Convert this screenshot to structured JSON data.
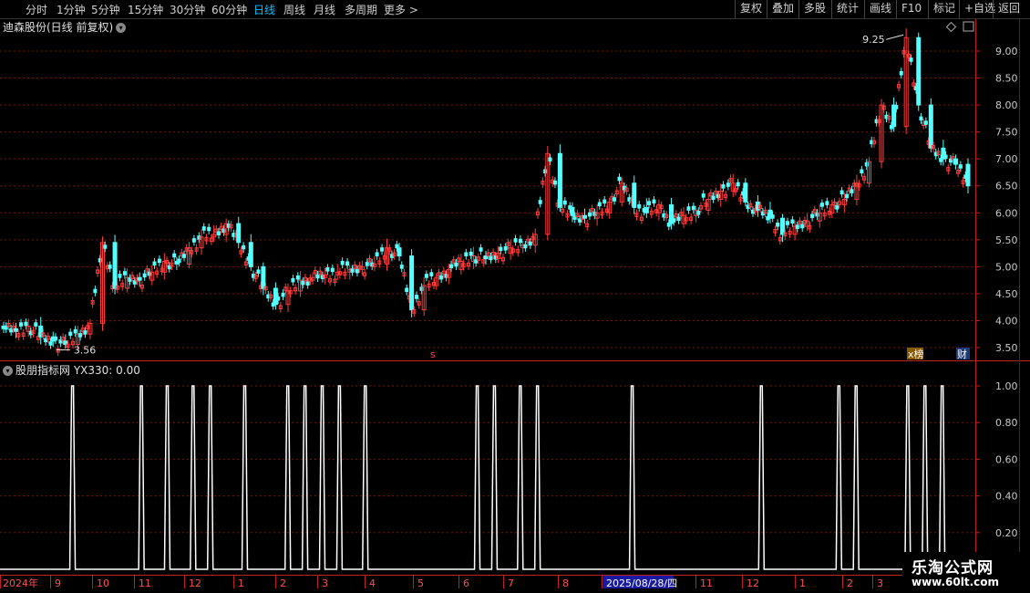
{
  "toolbar": {
    "periods": [
      "分时",
      "1分钟",
      "5分钟",
      "15分钟",
      "30分钟",
      "60分钟",
      "日线",
      "周线",
      "月线",
      "多周期",
      "更多 >"
    ],
    "active_period": "日线",
    "right_buttons": [
      "复权",
      "叠加",
      "多股",
      "统计",
      "画线",
      "F10",
      "标记",
      "+自选",
      "返回"
    ]
  },
  "main_chart": {
    "stock_title": "迪森股份(日线 前复权)",
    "high_label": "9.25",
    "low_label": "3.56",
    "y_axis_labels": [
      "9.00",
      "8.50",
      "8.00",
      "7.50",
      "7.00",
      "6.50",
      "6.00",
      "5.50",
      "5.00",
      "4.50",
      "4.00",
      "3.50"
    ],
    "markers": {
      "s_marker": "s",
      "rank_marker": "x榜",
      "fin_marker": "财"
    }
  },
  "indicator": {
    "title": "股朋指标网",
    "value_label": "YX330: 0.00",
    "y_axis_labels": [
      "1.00",
      "0.80",
      "0.60",
      "0.40",
      "0.20"
    ]
  },
  "time_axis": {
    "labels": [
      "2024年",
      "9",
      "10",
      "11",
      "12",
      "1",
      "2",
      "3",
      "4",
      "5",
      "6",
      "7",
      "8",
      "2025/08/28/四",
      "11",
      "12",
      "1",
      "2",
      "3"
    ]
  },
  "watermark": {
    "title": "乐淘公式网",
    "url": "www.60lt.com"
  },
  "colors": {
    "up": "#ff3c3c",
    "down": "#54ffff",
    "grid": "#7a1010",
    "axis": "#c02020",
    "indicator_line": "#ffffff",
    "active": "#00c0ff"
  },
  "chart_data": {
    "type": "line",
    "title": "迪森股份(日线 前复权)",
    "ylim": [
      3.4,
      9.3
    ],
    "x_range": [
      "2024-08",
      "2026-03"
    ],
    "series": [
      {
        "name": "close",
        "values": [
          3.85,
          3.8,
          3.9,
          3.7,
          3.62,
          3.56,
          3.75,
          3.95,
          5.45,
          4.6,
          4.8,
          4.75,
          4.9,
          5.1,
          5.05,
          5.35,
          5.55,
          5.6,
          5.8,
          5.45,
          5.0,
          4.6,
          4.3,
          4.55,
          4.75,
          4.8,
          4.85,
          4.9,
          4.95,
          5.0,
          5.05,
          5.35,
          5.2,
          4.2,
          4.65,
          4.8,
          4.95,
          5.1,
          5.2,
          5.15,
          5.25,
          5.35,
          5.4,
          5.6,
          7.1,
          6.1,
          5.95,
          5.9,
          6.0,
          6.2,
          6.55,
          6.1,
          6.0,
          6.15,
          5.8,
          5.95,
          6.05,
          6.25,
          6.4,
          6.55,
          6.2,
          6.05,
          5.9,
          5.6,
          5.75,
          5.85,
          6.0,
          6.15,
          6.25,
          6.55,
          6.95,
          8.0,
          7.6,
          9.25,
          8.0,
          7.2,
          7.0,
          6.9,
          6.5
        ]
      },
      {
        "name": "YX330",
        "x_index": [
          8,
          16,
          19,
          22,
          24,
          28,
          33,
          35,
          37,
          39,
          42,
          55,
          57,
          60,
          62,
          73,
          88,
          97,
          99,
          105,
          107,
          109
        ],
        "values": [
          1,
          1,
          1,
          1,
          1,
          1,
          1,
          1,
          1,
          1,
          1,
          1,
          1,
          1,
          1,
          1,
          1,
          1,
          1,
          1,
          1,
          1
        ]
      }
    ],
    "indicator_ylim": [
      0,
      1.05
    ],
    "grid": true
  }
}
